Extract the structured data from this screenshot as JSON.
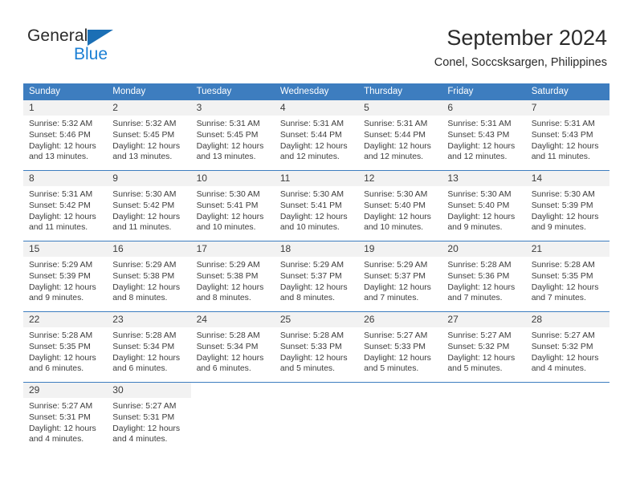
{
  "brand": {
    "name_top": "General",
    "name_bottom": "Blue",
    "triangle_color": "#1b6fb5",
    "blue_color": "#1b7fd4"
  },
  "header": {
    "title": "September 2024",
    "subtitle": "Conel, Soccsksargen, Philippines"
  },
  "theme": {
    "header_row_bg": "#3d7dbf",
    "daynum_bg": "#f2f2f2",
    "cell_bg": "#ffffff",
    "text": "#3c3c3c"
  },
  "weekdays": [
    "Sunday",
    "Monday",
    "Tuesday",
    "Wednesday",
    "Thursday",
    "Friday",
    "Saturday"
  ],
  "weeks": [
    [
      {
        "day": "1",
        "sunrise": "Sunrise: 5:32 AM",
        "sunset": "Sunset: 5:46 PM",
        "daylight1": "Daylight: 12 hours",
        "daylight2": "and 13 minutes."
      },
      {
        "day": "2",
        "sunrise": "Sunrise: 5:32 AM",
        "sunset": "Sunset: 5:45 PM",
        "daylight1": "Daylight: 12 hours",
        "daylight2": "and 13 minutes."
      },
      {
        "day": "3",
        "sunrise": "Sunrise: 5:31 AM",
        "sunset": "Sunset: 5:45 PM",
        "daylight1": "Daylight: 12 hours",
        "daylight2": "and 13 minutes."
      },
      {
        "day": "4",
        "sunrise": "Sunrise: 5:31 AM",
        "sunset": "Sunset: 5:44 PM",
        "daylight1": "Daylight: 12 hours",
        "daylight2": "and 12 minutes."
      },
      {
        "day": "5",
        "sunrise": "Sunrise: 5:31 AM",
        "sunset": "Sunset: 5:44 PM",
        "daylight1": "Daylight: 12 hours",
        "daylight2": "and 12 minutes."
      },
      {
        "day": "6",
        "sunrise": "Sunrise: 5:31 AM",
        "sunset": "Sunset: 5:43 PM",
        "daylight1": "Daylight: 12 hours",
        "daylight2": "and 12 minutes."
      },
      {
        "day": "7",
        "sunrise": "Sunrise: 5:31 AM",
        "sunset": "Sunset: 5:43 PM",
        "daylight1": "Daylight: 12 hours",
        "daylight2": "and 11 minutes."
      }
    ],
    [
      {
        "day": "8",
        "sunrise": "Sunrise: 5:31 AM",
        "sunset": "Sunset: 5:42 PM",
        "daylight1": "Daylight: 12 hours",
        "daylight2": "and 11 minutes."
      },
      {
        "day": "9",
        "sunrise": "Sunrise: 5:30 AM",
        "sunset": "Sunset: 5:42 PM",
        "daylight1": "Daylight: 12 hours",
        "daylight2": "and 11 minutes."
      },
      {
        "day": "10",
        "sunrise": "Sunrise: 5:30 AM",
        "sunset": "Sunset: 5:41 PM",
        "daylight1": "Daylight: 12 hours",
        "daylight2": "and 10 minutes."
      },
      {
        "day": "11",
        "sunrise": "Sunrise: 5:30 AM",
        "sunset": "Sunset: 5:41 PM",
        "daylight1": "Daylight: 12 hours",
        "daylight2": "and 10 minutes."
      },
      {
        "day": "12",
        "sunrise": "Sunrise: 5:30 AM",
        "sunset": "Sunset: 5:40 PM",
        "daylight1": "Daylight: 12 hours",
        "daylight2": "and 10 minutes."
      },
      {
        "day": "13",
        "sunrise": "Sunrise: 5:30 AM",
        "sunset": "Sunset: 5:40 PM",
        "daylight1": "Daylight: 12 hours",
        "daylight2": "and 9 minutes."
      },
      {
        "day": "14",
        "sunrise": "Sunrise: 5:30 AM",
        "sunset": "Sunset: 5:39 PM",
        "daylight1": "Daylight: 12 hours",
        "daylight2": "and 9 minutes."
      }
    ],
    [
      {
        "day": "15",
        "sunrise": "Sunrise: 5:29 AM",
        "sunset": "Sunset: 5:39 PM",
        "daylight1": "Daylight: 12 hours",
        "daylight2": "and 9 minutes."
      },
      {
        "day": "16",
        "sunrise": "Sunrise: 5:29 AM",
        "sunset": "Sunset: 5:38 PM",
        "daylight1": "Daylight: 12 hours",
        "daylight2": "and 8 minutes."
      },
      {
        "day": "17",
        "sunrise": "Sunrise: 5:29 AM",
        "sunset": "Sunset: 5:38 PM",
        "daylight1": "Daylight: 12 hours",
        "daylight2": "and 8 minutes."
      },
      {
        "day": "18",
        "sunrise": "Sunrise: 5:29 AM",
        "sunset": "Sunset: 5:37 PM",
        "daylight1": "Daylight: 12 hours",
        "daylight2": "and 8 minutes."
      },
      {
        "day": "19",
        "sunrise": "Sunrise: 5:29 AM",
        "sunset": "Sunset: 5:37 PM",
        "daylight1": "Daylight: 12 hours",
        "daylight2": "and 7 minutes."
      },
      {
        "day": "20",
        "sunrise": "Sunrise: 5:28 AM",
        "sunset": "Sunset: 5:36 PM",
        "daylight1": "Daylight: 12 hours",
        "daylight2": "and 7 minutes."
      },
      {
        "day": "21",
        "sunrise": "Sunrise: 5:28 AM",
        "sunset": "Sunset: 5:35 PM",
        "daylight1": "Daylight: 12 hours",
        "daylight2": "and 7 minutes."
      }
    ],
    [
      {
        "day": "22",
        "sunrise": "Sunrise: 5:28 AM",
        "sunset": "Sunset: 5:35 PM",
        "daylight1": "Daylight: 12 hours",
        "daylight2": "and 6 minutes."
      },
      {
        "day": "23",
        "sunrise": "Sunrise: 5:28 AM",
        "sunset": "Sunset: 5:34 PM",
        "daylight1": "Daylight: 12 hours",
        "daylight2": "and 6 minutes."
      },
      {
        "day": "24",
        "sunrise": "Sunrise: 5:28 AM",
        "sunset": "Sunset: 5:34 PM",
        "daylight1": "Daylight: 12 hours",
        "daylight2": "and 6 minutes."
      },
      {
        "day": "25",
        "sunrise": "Sunrise: 5:28 AM",
        "sunset": "Sunset: 5:33 PM",
        "daylight1": "Daylight: 12 hours",
        "daylight2": "and 5 minutes."
      },
      {
        "day": "26",
        "sunrise": "Sunrise: 5:27 AM",
        "sunset": "Sunset: 5:33 PM",
        "daylight1": "Daylight: 12 hours",
        "daylight2": "and 5 minutes."
      },
      {
        "day": "27",
        "sunrise": "Sunrise: 5:27 AM",
        "sunset": "Sunset: 5:32 PM",
        "daylight1": "Daylight: 12 hours",
        "daylight2": "and 5 minutes."
      },
      {
        "day": "28",
        "sunrise": "Sunrise: 5:27 AM",
        "sunset": "Sunset: 5:32 PM",
        "daylight1": "Daylight: 12 hours",
        "daylight2": "and 4 minutes."
      }
    ],
    [
      {
        "day": "29",
        "sunrise": "Sunrise: 5:27 AM",
        "sunset": "Sunset: 5:31 PM",
        "daylight1": "Daylight: 12 hours",
        "daylight2": "and 4 minutes."
      },
      {
        "day": "30",
        "sunrise": "Sunrise: 5:27 AM",
        "sunset": "Sunset: 5:31 PM",
        "daylight1": "Daylight: 12 hours",
        "daylight2": "and 4 minutes."
      },
      {
        "day": "",
        "sunrise": "",
        "sunset": "",
        "daylight1": "",
        "daylight2": ""
      },
      {
        "day": "",
        "sunrise": "",
        "sunset": "",
        "daylight1": "",
        "daylight2": ""
      },
      {
        "day": "",
        "sunrise": "",
        "sunset": "",
        "daylight1": "",
        "daylight2": ""
      },
      {
        "day": "",
        "sunrise": "",
        "sunset": "",
        "daylight1": "",
        "daylight2": ""
      },
      {
        "day": "",
        "sunrise": "",
        "sunset": "",
        "daylight1": "",
        "daylight2": ""
      }
    ]
  ]
}
